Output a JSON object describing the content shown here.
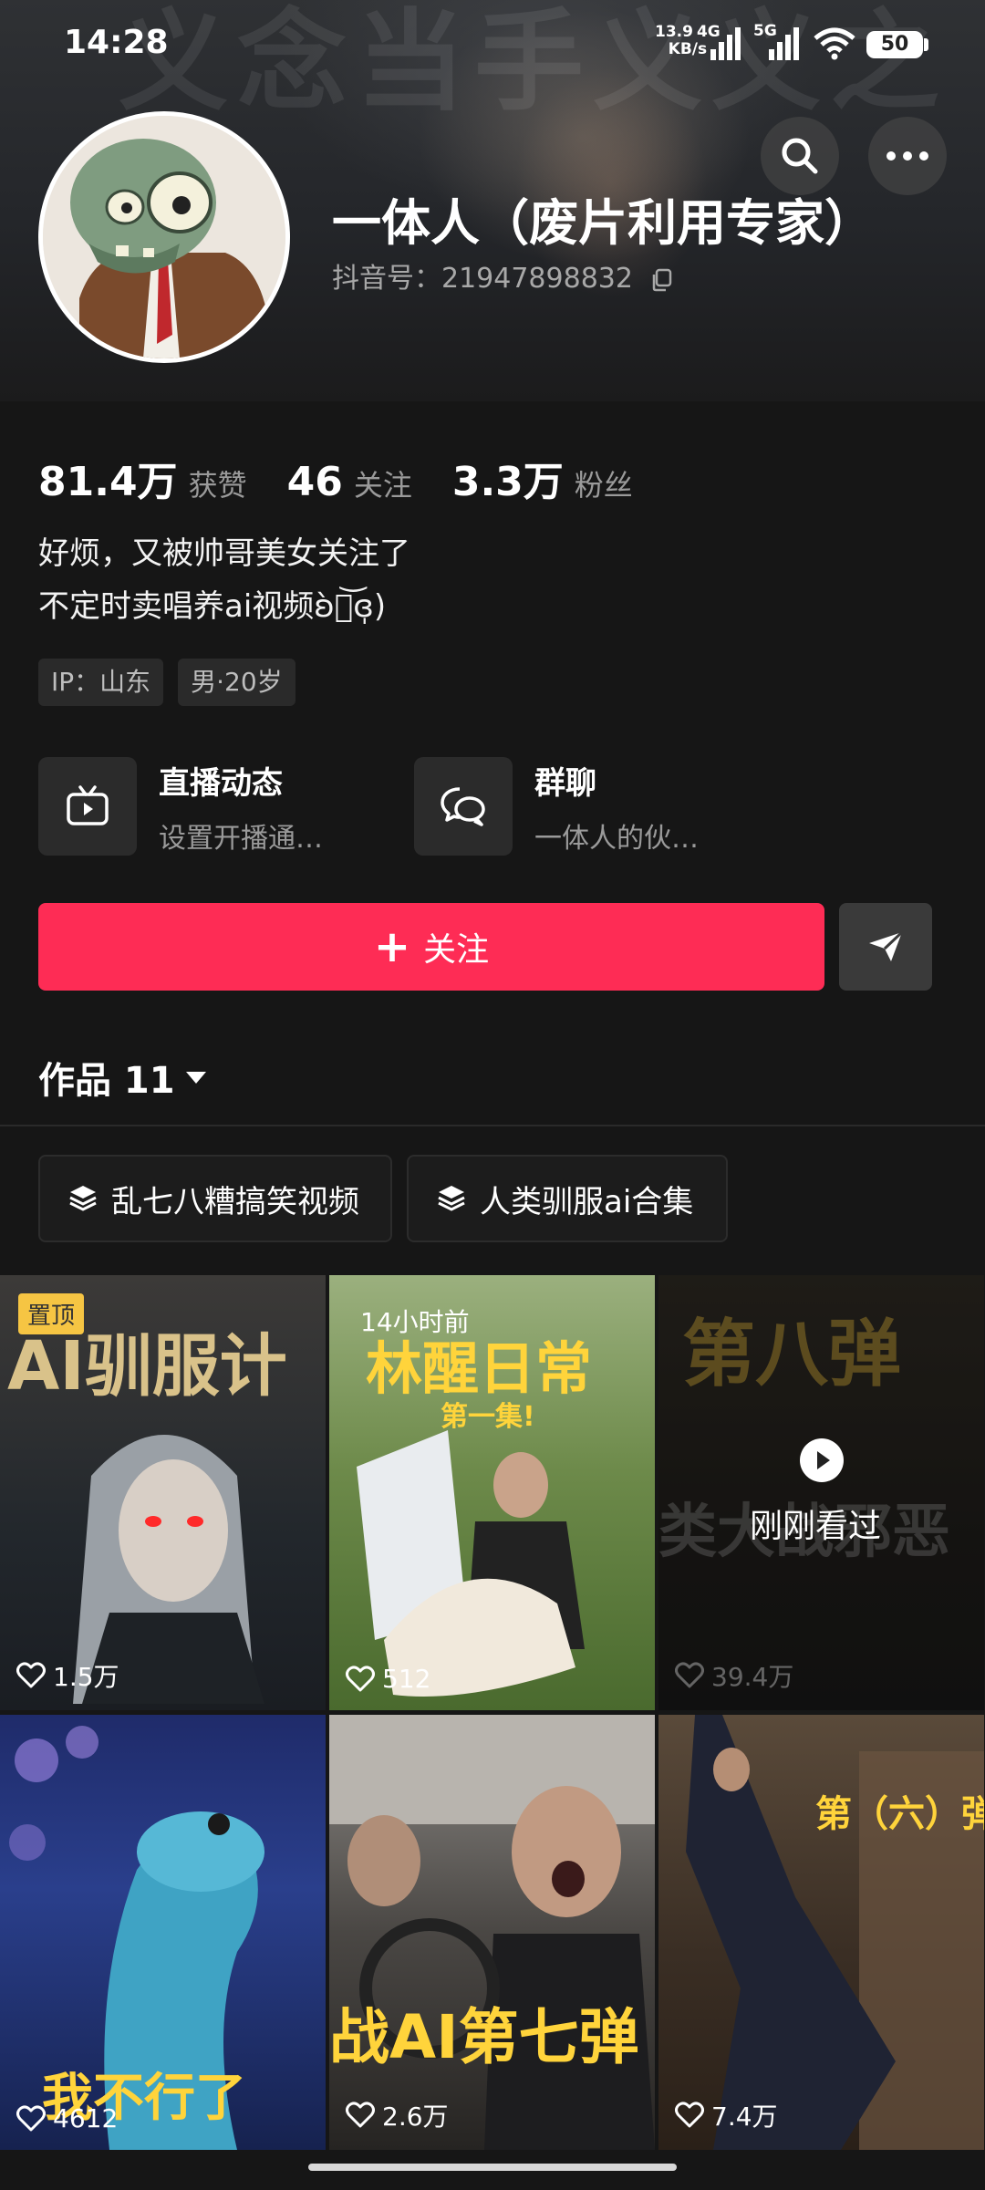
{
  "status_bar": {
    "time": "14:28",
    "net_speed_value": "13.9",
    "net_speed_unit": "KB/s",
    "net_type_1": "4G",
    "net_type_2": "5G",
    "battery": "50",
    "wifi_icon": "wifi-icon",
    "signal_icon": "signal-icon"
  },
  "banner": {
    "overlay_text": "义念当手义义之"
  },
  "header": {
    "search_icon": "search-icon",
    "more_icon": "more-icon"
  },
  "profile": {
    "nickname": "一体人（废片利用专家）",
    "douyin_id": "抖音号：21947898832",
    "copy_icon": "copy-icon"
  },
  "stats": [
    {
      "value": "81.4万",
      "label": "获赞"
    },
    {
      "value": "46",
      "label": "关注"
    },
    {
      "value": "3.3万",
      "label": "粉丝"
    }
  ],
  "bio": {
    "line1": "好烦，又被帅哥美女关注了",
    "line2": "不定时卖唱养ai视频ʚ̀ꈊ͝ɞ̩)"
  },
  "tags": [
    "IP：山东",
    "男·20岁"
  ],
  "features": [
    {
      "title": "直播动态",
      "subtitle": "设置开播通…",
      "icon": "live-tv-icon"
    },
    {
      "title": "群聊",
      "subtitle": "一体人的伙…",
      "icon": "group-chat-icon"
    }
  ],
  "follow": {
    "label": "关注",
    "share_icon": "share-icon"
  },
  "works": {
    "label": "作品 11"
  },
  "collections": [
    "乱七八糟搞笑视频",
    "人类驯服ai合集"
  ],
  "videos": [
    {
      "likes": "1.5万",
      "badge": "置顶",
      "overlay": "AI驯服计"
    },
    {
      "likes": "512",
      "time_ago": "14小时前",
      "overlay": "林醒日常",
      "overlay_sub": "第一集!"
    },
    {
      "likes": "39.4万",
      "overlay": "第八弹",
      "overlay_sub": "类大战邪恶",
      "watched": "刚刚看过"
    },
    {
      "likes": "4612",
      "overlay": "我不行了"
    },
    {
      "likes": "2.6万",
      "overlay": "战AI第七弹"
    },
    {
      "likes": "7.4万",
      "overlay": "第（六）弹"
    }
  ]
}
